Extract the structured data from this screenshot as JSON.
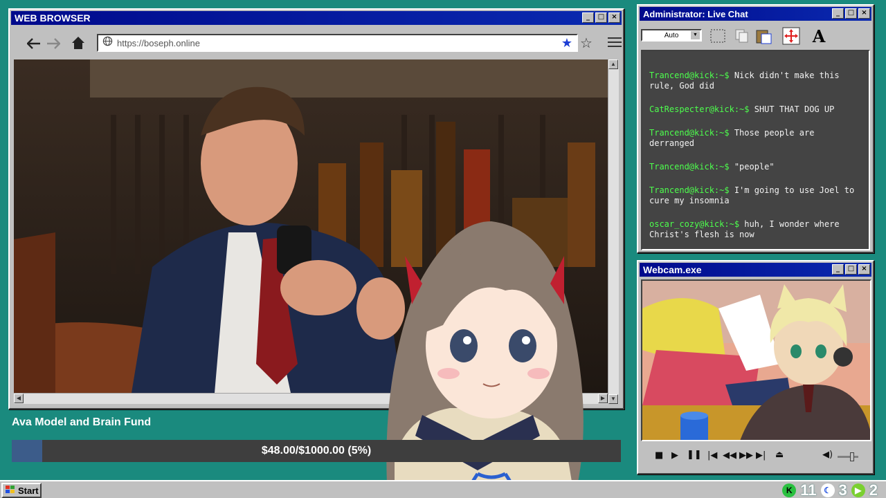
{
  "browser": {
    "title": "WEB BROWSER",
    "url": "https://boseph.online",
    "back_icon": "back-arrow-icon",
    "forward_icon": "forward-arrow-icon",
    "home_icon": "home-icon"
  },
  "chat": {
    "title": "Administrator: Live Chat",
    "font_size_select": "Auto",
    "messages": [
      {
        "user": "Trancend@kick:~$",
        "text": "Nick didn't make this rule, God did"
      },
      {
        "user": "CatRespecter@kick:~$",
        "text": "SHUT THAT DOG UP"
      },
      {
        "user": "Trancend@kick:~$",
        "text": "Those people are derranged"
      },
      {
        "user": "Trancend@kick:~$",
        "text": "\"people\""
      },
      {
        "user": "Trancend@kick:~$",
        "text": "I'm going to use Joel to cure my insomnia"
      },
      {
        "user": "oscar_cozy@kick:~$",
        "text": "huh, I wonder where Christ's flesh is now"
      }
    ],
    "user_color": "#4dff4d"
  },
  "webcam": {
    "title": "Webcam.exe"
  },
  "fund": {
    "title": "Ava Model and Brain Fund",
    "progress_text": "$48.00/$1000.00 (5%)",
    "raised": 48.0,
    "goal": 1000.0,
    "percent": 5
  },
  "taskbar": {
    "start_label": "Start",
    "count_1": "11",
    "count_2": "3",
    "count_3": "2"
  },
  "colors": {
    "desktop": "#1a8a7e",
    "titlebar": "#000a8c",
    "fund_fill": "#3c5c8a"
  }
}
